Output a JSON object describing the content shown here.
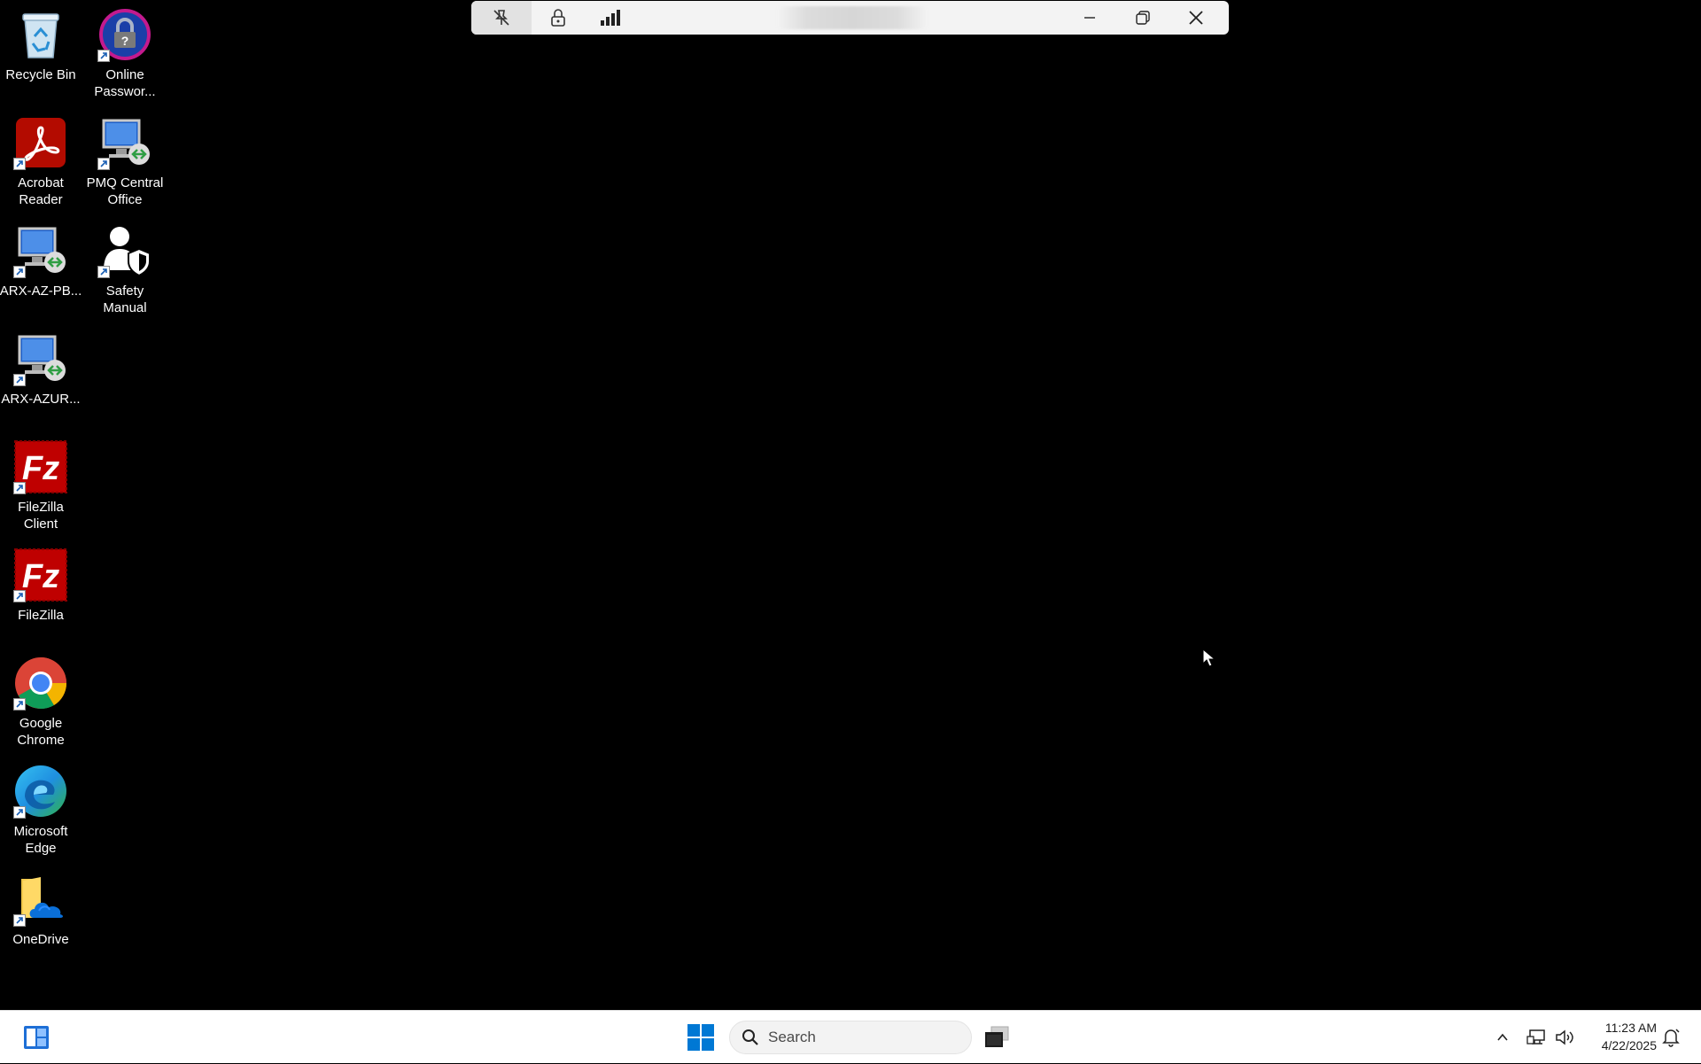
{
  "desktop": {
    "icons": [
      {
        "label": "Recycle Bin",
        "icon": "recycle-bin-icon"
      },
      {
        "label": "Online\nPasswor...",
        "icon": "password-lock-icon"
      },
      {
        "label": "Acrobat\nReader",
        "icon": "acrobat-reader-icon"
      },
      {
        "label": "PMQ Central\nOffice",
        "icon": "remote-desktop-icon"
      },
      {
        "label": "ARX-AZ-PB...",
        "icon": "remote-desktop-icon"
      },
      {
        "label": "Safety\nManual",
        "icon": "safety-user-shield-icon"
      },
      {
        "label": "ARX-AZUR...",
        "icon": "remote-desktop-icon"
      },
      {
        "label": "FileZilla\nClient",
        "icon": "filezilla-icon"
      },
      {
        "label": "FileZilla",
        "icon": "filezilla-icon"
      },
      {
        "label": "Google\nChrome",
        "icon": "chrome-icon"
      },
      {
        "label": "Microsoft\nEdge",
        "icon": "edge-icon"
      },
      {
        "label": "OneDrive",
        "icon": "onedrive-folder-icon"
      }
    ]
  },
  "connection_bar": {
    "pin_icon": "pin-off-icon",
    "lock_icon": "lock-icon",
    "signal_icon": "signal-bars-icon",
    "minimize_icon": "minimize-icon",
    "restore_icon": "restore-icon",
    "close_icon": "close-icon"
  },
  "taskbar": {
    "search_placeholder": "Search",
    "clock": {
      "time": "11:23 AM",
      "date": "4/22/2025"
    },
    "colors": {
      "windows_blue": "#0078d4",
      "accent": "#0067c0"
    }
  }
}
